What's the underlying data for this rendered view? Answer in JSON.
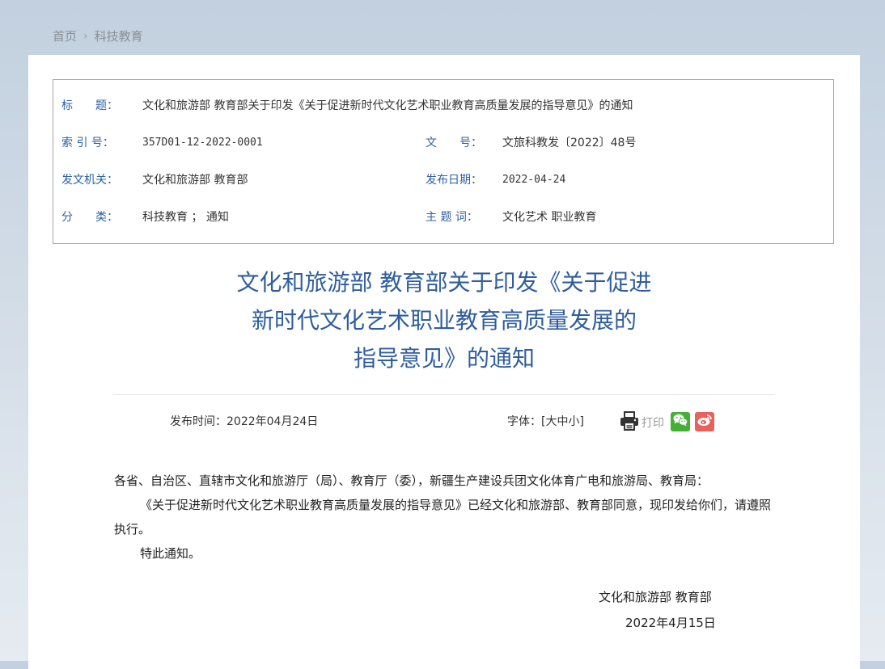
{
  "breadcrumb": {
    "home": "首页",
    "section": "科技教育"
  },
  "meta": {
    "title_label": "标　　题：",
    "title_value": "文化和旅游部 教育部关于印发《关于促进新时代文化艺术职业教育高质量发展的指导意见》的通知",
    "index_label": "索 引 号：",
    "index_value": "357D01-12-2022-0001",
    "docno_label": "文　　号：",
    "docno_value": "文旅科教发〔2022〕48号",
    "issuer_label": "发文机关：",
    "issuer_value": "文化和旅游部 教育部",
    "date_label": "发布日期：",
    "date_value": "2022-04-24",
    "category_label": "分　　类：",
    "category_value": "科技教育 ； 通知",
    "keywords_label": "主 题 词：",
    "keywords_value": "文化艺术 职业教育"
  },
  "doc_title": {
    "line1": "文化和旅游部 教育部关于印发《关于促进",
    "line2": "新时代文化艺术职业教育高质量发展的",
    "line3": "指导意见》的通知"
  },
  "pub": {
    "time_label": "发布时间：",
    "time_value": "2022年04月24日",
    "font_label": "字体：",
    "font_open": "[",
    "font_large": "大",
    "font_medium": "中",
    "font_small": "小",
    "font_close": "]",
    "print_label": "打印"
  },
  "body": {
    "p1": "各省、自治区、直辖市文化和旅游厅（局）、教育厅（委），新疆生产建设兵团文化体育广电和旅游局、教育局：",
    "p2": "《关于促进新时代文化艺术职业教育高质量发展的指导意见》已经文化和旅游部、教育部同意，现印发给你们，请遵照执行。",
    "p3": "特此通知。"
  },
  "signature": {
    "org": "文化和旅游部 教育部",
    "date": "2022年4月15日"
  },
  "icons": {
    "print": "printer-icon",
    "wechat": "wechat-icon",
    "weibo": "weibo-icon"
  },
  "colors": {
    "label_blue": "#2c61a3",
    "title_blue": "#2f5d9e",
    "wechat_green": "#45b035",
    "weibo_red": "#e8615a"
  }
}
